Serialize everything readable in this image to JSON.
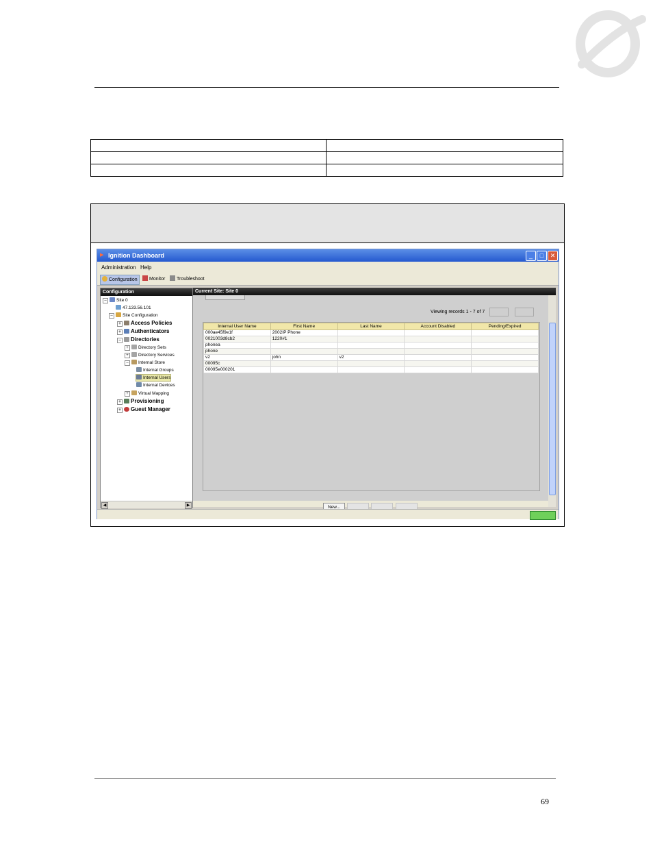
{
  "page_number": "69",
  "window": {
    "title": "Ignition Dashboard",
    "menu": [
      "Administration",
      "Help"
    ],
    "toolbar": [
      "Configuration",
      "Monitor",
      "Troubleshoot"
    ]
  },
  "left_pane": {
    "header": "Configuration",
    "tree": [
      "Site 0",
      "47.133.56.101",
      "Site Configuration",
      "Access Policies",
      "Authenticators",
      "Directories",
      "Directory Sets",
      "Directory Services",
      "Internal Store",
      "Internal Groups",
      "Internal Users",
      "Internal Devices",
      "Virtual Mapping",
      "Provisioning",
      "Guest Manager"
    ]
  },
  "right_pane": {
    "header": "Current Site: Site 0",
    "viewing": "Viewing records 1 - 7 of 7",
    "columns": [
      "Internal User Name",
      "First Name",
      "Last Name",
      "Account Disabled",
      "Pending/Expired"
    ],
    "rows": [
      [
        "000ae45f9e1f",
        "2002IP Phone",
        "",
        "",
        ""
      ],
      [
        "0021003d8cb2",
        "1220#1",
        "",
        "",
        ""
      ],
      [
        "phonea",
        "",
        "",
        "",
        ""
      ],
      [
        "phone",
        "",
        "",
        "",
        ""
      ],
      [
        "v2",
        "john",
        "v2",
        "",
        ""
      ],
      [
        "00095c",
        "",
        "",
        "",
        ""
      ],
      [
        "00095e000201",
        "",
        "",
        "",
        ""
      ]
    ],
    "new_button": "New..."
  }
}
